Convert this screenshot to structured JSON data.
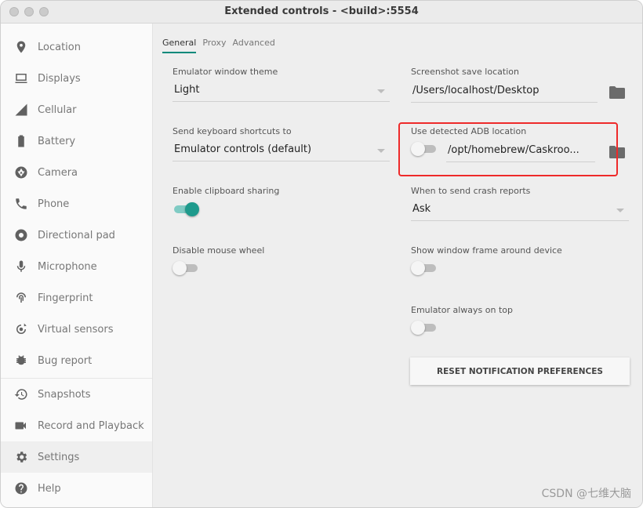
{
  "window": {
    "title": "Extended controls - <build>:5554"
  },
  "sidebar": {
    "items": [
      {
        "label": "Location"
      },
      {
        "label": "Displays"
      },
      {
        "label": "Cellular"
      },
      {
        "label": "Battery"
      },
      {
        "label": "Camera"
      },
      {
        "label": "Phone"
      },
      {
        "label": "Directional pad"
      },
      {
        "label": "Microphone"
      },
      {
        "label": "Fingerprint"
      },
      {
        "label": "Virtual sensors"
      },
      {
        "label": "Bug report"
      },
      {
        "label": "Snapshots"
      },
      {
        "label": "Record and Playback"
      },
      {
        "label": "Settings"
      },
      {
        "label": "Help"
      }
    ]
  },
  "tabs": [
    {
      "label": "General"
    },
    {
      "label": "Proxy"
    },
    {
      "label": "Advanced"
    }
  ],
  "settings": {
    "theme": {
      "label": "Emulator window theme",
      "value": "Light"
    },
    "screenshot": {
      "label": "Screenshot save location",
      "value": "/Users/localhost/Desktop"
    },
    "shortcuts": {
      "label": "Send keyboard shortcuts to",
      "value": "Emulator controls (default)"
    },
    "adb": {
      "label": "Use detected ADB location",
      "value": "/opt/homebrew/Caskroo...",
      "enabled": false
    },
    "clipboard": {
      "label": "Enable clipboard sharing",
      "enabled": true
    },
    "crash": {
      "label": "When to send crash reports",
      "value": "Ask"
    },
    "mouse_wheel": {
      "label": "Disable mouse wheel",
      "enabled": false
    },
    "window_frame": {
      "label": "Show window frame around device",
      "enabled": false
    },
    "always_on_top": {
      "label": "Emulator always on top",
      "enabled": false
    },
    "reset_button": "RESET NOTIFICATION PREFERENCES"
  },
  "colors": {
    "accent": "#1e9a8c",
    "highlight": "#ee2a2a"
  },
  "watermark": "CSDN @七维大脑"
}
